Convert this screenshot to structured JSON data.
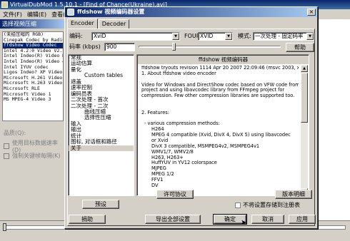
{
  "background_window": {
    "title": "VirtualDubMod 1.5.10.1 - [Find of Chance(Ukraine).avi]",
    "menu": [
      "文件(F)",
      "编辑(E)",
      "查看(V)"
    ]
  },
  "compression_dialog": {
    "title": "选择视频压缩",
    "codecs": [
      "(未经压缩的 RGB)",
      "Cinepak Codec by Radius",
      "ffdshow Video Codec",
      "Intel 4.2:0 Video V2.50",
      "Intel Indeo(R) Video R3.2",
      "Intel Indeo(R) Video 4.5",
      "Intel IYUV codec",
      "Ligos Indeo? XP Video 5.2",
      "Microsoft H.261 Video Codec",
      "Microsoft H.263 Video Codec",
      "Microsoft RLE",
      "Microsoft Video 1",
      "MS MPEG-4 Video 3"
    ],
    "selected_index": 2,
    "quality_label": "品质(Q):",
    "options": [
      "使用目标数据速率(D)",
      "强制关键帧每隔(K)"
    ]
  },
  "ffdshow": {
    "title": "ffdshow 视频编码器设置",
    "close_glyph": "×",
    "tabs": [
      "Encoder",
      "Decoder"
    ],
    "active_tab": 0,
    "encoder_label": "编码:",
    "encoder_value": "XviD",
    "fourcc_label": "FOURCC:",
    "fourcc_value": "XVID",
    "mode_label": "模式:",
    "mode_value": "一次处理 - 固定码率",
    "bitrate_label": "码率 (kbps)",
    "bitrate_value": "900",
    "help_button": "帮助",
    "tree": [
      {
        "label": "常规",
        "level": 1
      },
      {
        "label": "运动估算",
        "level": 1
      },
      {
        "label": "量化",
        "level": 1
      },
      {
        "label": "Custom tables",
        "level": 2
      },
      {
        "label": "遮盖",
        "level": 1
      },
      {
        "label": "速率控制",
        "level": 1
      },
      {
        "label": "编码员表",
        "level": 1
      },
      {
        "label": "二次处理 - 首次",
        "level": 1
      },
      {
        "label": "二次处理 - 二次",
        "level": 1
      },
      {
        "label": "曲线压缩",
        "level": 2
      },
      {
        "label": "选择性压缩",
        "level": 2
      },
      {
        "label": "输入",
        "level": 1
      },
      {
        "label": "输出",
        "level": 1
      },
      {
        "label": "统计",
        "level": 1
      },
      {
        "label": "图标, 对话框和路径",
        "level": 1
      },
      {
        "label": "关于",
        "level": 1
      }
    ],
    "selected_tree_index": 15,
    "info_header": "ffdshow 视频编码器",
    "info_lines": [
      {
        "text": "ffdshow tryouts revision 1114  Apr 20 2007 22:09:46 (msvc 2003, x86, ansi)",
        "indent": 0
      },
      {
        "text": "1. About ffdshow video encoder",
        "indent": 0
      },
      {
        "text": "",
        "indent": 0
      },
      {
        "text": "Video for Windows and DirectShow codec based on VFW code from Xvid",
        "indent": 0
      },
      {
        "text": "project and using libavcodec library from FFmpeg project for",
        "indent": 0
      },
      {
        "text": "compression. Few other compression libraries are supported too.",
        "indent": 0
      },
      {
        "text": "",
        "indent": 0
      },
      {
        "text": "",
        "indent": 0
      },
      {
        "text": "2. Features:",
        "indent": 0
      },
      {
        "text": "",
        "indent": 0
      },
      {
        "text": "- various compression methods:",
        "indent": 1
      },
      {
        "text": "H264",
        "indent": 2
      },
      {
        "text": "MPEG 4 compatible (Xvid, DivX 4, DivX 5) using libavcodec",
        "indent": 2
      },
      {
        "text": "or Xvid",
        "indent": 2
      },
      {
        "text": "DivX 3 compatible, MSMPEG4v2, MSMPEG4v1",
        "indent": 2
      },
      {
        "text": "WMV1/7, WMV2/8",
        "indent": 2
      },
      {
        "text": "H263, H263+",
        "indent": 2
      },
      {
        "text": "HuffYUV in YV12 colorspace",
        "indent": 2
      },
      {
        "text": "MJPEG",
        "indent": 2
      },
      {
        "text": "MPEG 1/2",
        "indent": 2
      },
      {
        "text": "FFV1",
        "indent": 2
      },
      {
        "text": "DV",
        "indent": 2
      }
    ],
    "preset_button": "预设",
    "license_button": "许可协议",
    "version_button": "版本明细",
    "checkbox_label": "不将设置存储到注册表",
    "bottom_buttons": {
      "donate": "捐助",
      "export": "导出全部设置",
      "ok": "确定",
      "cancel": "取消",
      "apply": "应用"
    }
  }
}
